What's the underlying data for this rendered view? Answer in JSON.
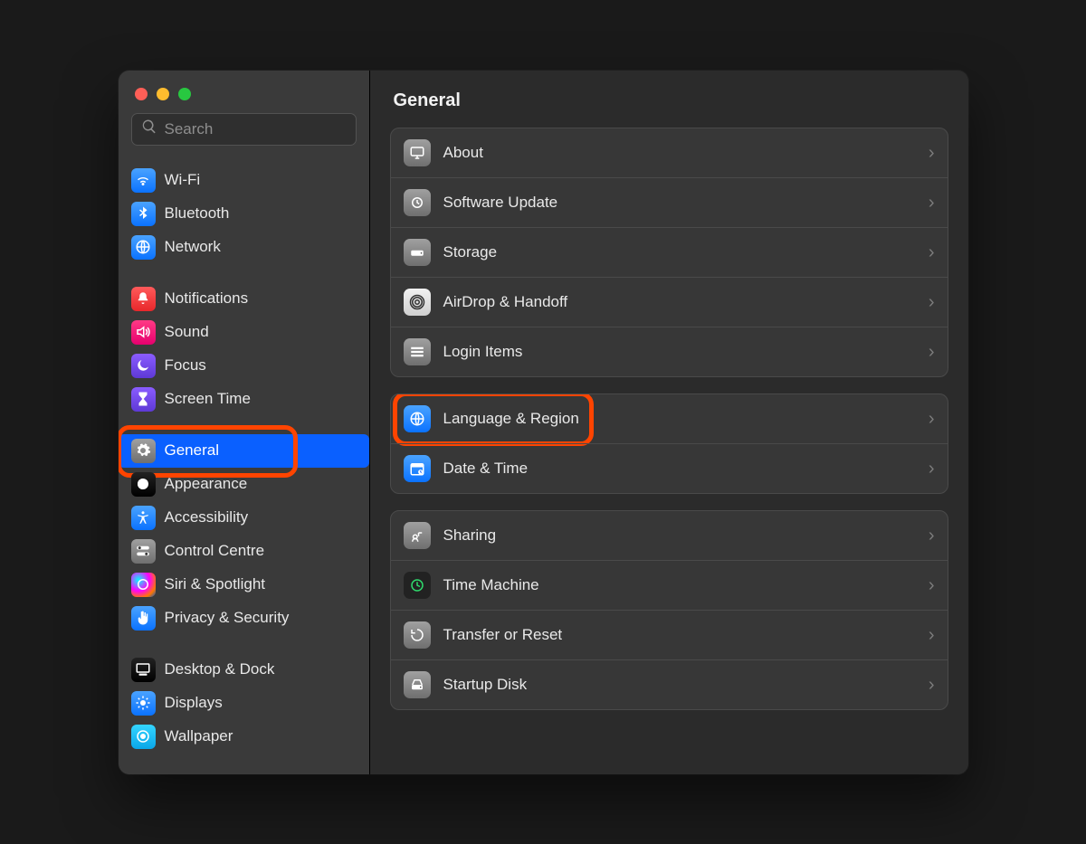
{
  "search": {
    "placeholder": "Search"
  },
  "sidebar": {
    "groups": [
      [
        {
          "label": "Wi-Fi",
          "iconClass": "g-blue",
          "iconName": "wifi-icon"
        },
        {
          "label": "Bluetooth",
          "iconClass": "g-blue",
          "iconName": "bluetooth-icon"
        },
        {
          "label": "Network",
          "iconClass": "g-blue",
          "iconName": "globe-icon"
        }
      ],
      [
        {
          "label": "Notifications",
          "iconClass": "g-red",
          "iconName": "bell-icon"
        },
        {
          "label": "Sound",
          "iconClass": "g-pink",
          "iconName": "sound-icon"
        },
        {
          "label": "Focus",
          "iconClass": "g-purple",
          "iconName": "moon-icon"
        },
        {
          "label": "Screen Time",
          "iconClass": "g-purple",
          "iconName": "hourglass-icon"
        }
      ],
      [
        {
          "label": "General",
          "iconClass": "g-grey",
          "iconName": "gear-icon",
          "selected": true,
          "highlight": true
        },
        {
          "label": "Appearance",
          "iconClass": "g-black",
          "iconName": "appearance-icon"
        },
        {
          "label": "Accessibility",
          "iconClass": "g-blue",
          "iconName": "accessibility-icon"
        },
        {
          "label": "Control Centre",
          "iconClass": "g-grey",
          "iconName": "switches-icon"
        },
        {
          "label": "Siri & Spotlight",
          "iconClass": "g-siri",
          "iconName": "siri-icon"
        },
        {
          "label": "Privacy & Security",
          "iconClass": "g-blue",
          "iconName": "hand-icon"
        }
      ],
      [
        {
          "label": "Desktop & Dock",
          "iconClass": "g-black",
          "iconName": "desktop-icon"
        },
        {
          "label": "Displays",
          "iconClass": "g-blue",
          "iconName": "brightness-icon"
        },
        {
          "label": "Wallpaper",
          "iconClass": "g-cyan",
          "iconName": "wallpaper-icon"
        }
      ]
    ]
  },
  "main": {
    "title": "General",
    "groups": [
      [
        {
          "label": "About",
          "iconClass": "g-grey",
          "iconName": "monitor-icon"
        },
        {
          "label": "Software Update",
          "iconClass": "g-grey",
          "iconName": "gear-refresh-icon"
        },
        {
          "label": "Storage",
          "iconClass": "g-grey",
          "iconName": "storage-icon"
        },
        {
          "label": "AirDrop & Handoff",
          "iconClass": "g-white",
          "iconName": "airdrop-icon"
        },
        {
          "label": "Login Items",
          "iconClass": "g-grey",
          "iconName": "list-icon"
        }
      ],
      [
        {
          "label": "Language & Region",
          "iconClass": "g-blue",
          "iconName": "globe-icon",
          "highlight": true
        },
        {
          "label": "Date & Time",
          "iconClass": "g-blue",
          "iconName": "calendar-icon"
        }
      ],
      [
        {
          "label": "Sharing",
          "iconClass": "g-grey",
          "iconName": "sharing-icon"
        },
        {
          "label": "Time Machine",
          "iconClass": "g-tm",
          "iconName": "timemachine-icon"
        },
        {
          "label": "Transfer or Reset",
          "iconClass": "g-grey",
          "iconName": "reset-icon"
        },
        {
          "label": "Startup Disk",
          "iconClass": "g-grey",
          "iconName": "disk-icon"
        }
      ]
    ]
  }
}
